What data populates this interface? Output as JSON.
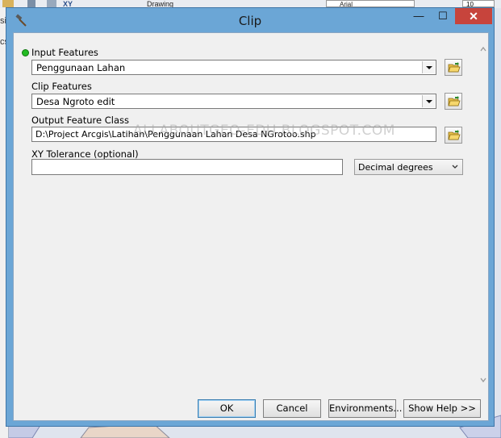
{
  "background": {
    "toolbar_drawing_label": "Drawing",
    "toolbar_font_name": "Arial",
    "toolbar_font_size": "10",
    "left_panel_fragments": [
      "si",
      "cs"
    ]
  },
  "window": {
    "title": "Clip",
    "close_glyph": "✕",
    "min_glyph": "—",
    "max_glyph": "☐"
  },
  "form": {
    "input_features": {
      "label": "Input Features",
      "value": "Penggunaan Lahan",
      "required": true
    },
    "clip_features": {
      "label": "Clip Features",
      "value": "Desa Ngroto edit"
    },
    "output_feature_class": {
      "label": "Output Feature Class",
      "value": "D:\\Project Arcgis\\Latihan\\Penggunaan Lahan Desa NGrotoo.shp"
    },
    "xy_tolerance": {
      "label": "XY Tolerance (optional)",
      "value": "",
      "unit": "Decimal degrees"
    }
  },
  "watermark": "ALLABOUTGEO-EDU.BLOGSPOT.COM",
  "buttons": {
    "ok": "OK",
    "cancel": "Cancel",
    "environments": "Environments...",
    "show_help": "Show Help >>"
  },
  "icons": {
    "title": "hammer-icon",
    "browse": "open-folder-icon"
  },
  "colors": {
    "titlebar": "#6ba6d6",
    "close_button": "#c7443c",
    "required_dot": "#22bb22"
  }
}
